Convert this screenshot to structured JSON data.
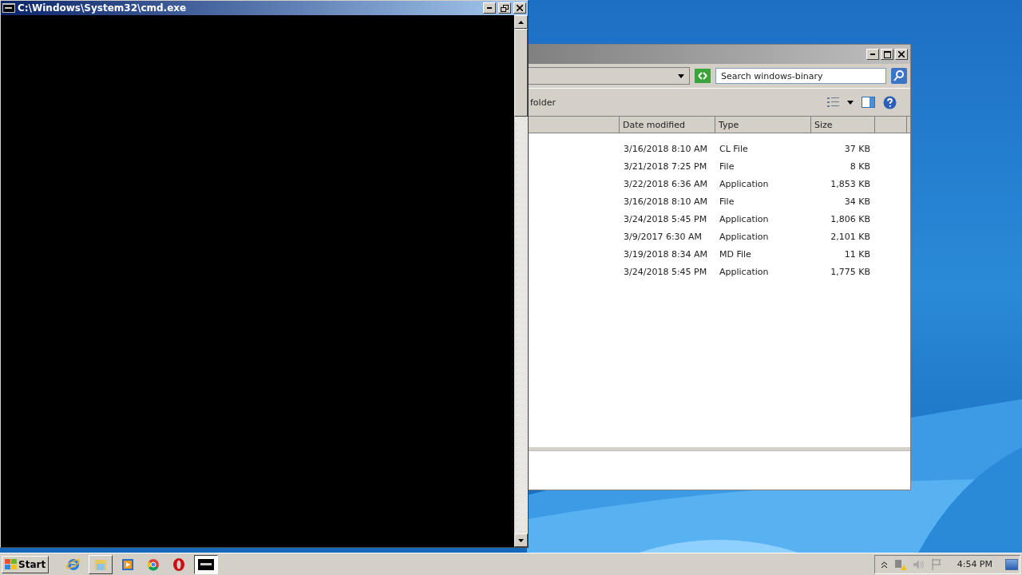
{
  "cmd_window": {
    "title": "C:\\Windows\\System32\\cmd.exe"
  },
  "explorer_window": {
    "search": {
      "placeholder": "Search windows-binary"
    },
    "toolbar": {
      "button_1": "folder"
    },
    "columns": [
      "Date modified",
      "Type",
      "Size"
    ],
    "rows": [
      {
        "date_modified": "3/16/2018 8:10 AM",
        "type": "CL File",
        "size": "37 KB"
      },
      {
        "date_modified": "3/21/2018 7:25 PM",
        "type": "File",
        "size": "8 KB"
      },
      {
        "date_modified": "3/22/2018 6:36 AM",
        "type": "Application",
        "size": "1,853 KB"
      },
      {
        "date_modified": "3/16/2018 8:10 AM",
        "type": "File",
        "size": "34 KB"
      },
      {
        "date_modified": "3/24/2018 5:45 PM",
        "type": "Application",
        "size": "1,806 KB"
      },
      {
        "date_modified": "3/9/2017 6:30 AM",
        "type": "Application",
        "size": "2,101 KB"
      },
      {
        "date_modified": "3/19/2018 8:34 AM",
        "type": "MD File",
        "size": "11 KB"
      },
      {
        "date_modified": "3/24/2018 5:45 PM",
        "type": "Application",
        "size": "1,775 KB"
      }
    ]
  },
  "taskbar": {
    "start": "Start",
    "clock": "4:54 PM",
    "apps": [
      {
        "kind": "ie",
        "selected": false
      },
      {
        "kind": "explorer",
        "selected": false
      },
      {
        "kind": "media",
        "selected": false
      },
      {
        "kind": "chrome",
        "selected": false
      },
      {
        "kind": "opera",
        "selected": false
      },
      {
        "kind": "cmd",
        "selected": true
      }
    ]
  }
}
